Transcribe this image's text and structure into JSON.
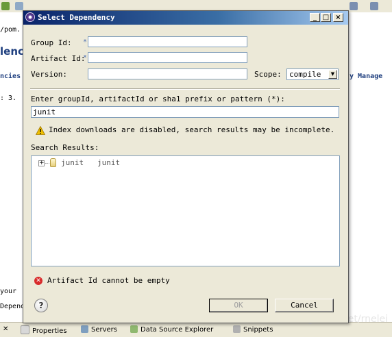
{
  "background": {
    "editor_fragments": [
      "/pom.",
      "lenc",
      "ncies",
      "y Manage",
      ": 3.",
      "your",
      "Depend"
    ],
    "bottom_tabs": [
      {
        "label": "Properties",
        "icon": "properties-icon"
      },
      {
        "label": "Servers",
        "icon": "servers-icon"
      },
      {
        "label": "Data Source Explorer",
        "icon": "data-source-icon"
      },
      {
        "label": "Snippets",
        "icon": "snippets-icon"
      }
    ],
    "watermark": "http://blog.csdn.net/rnelei"
  },
  "dialog": {
    "title": "Select Dependency",
    "window_controls": {
      "minimize": "_",
      "maximize": "□",
      "close": "×"
    },
    "group_id": {
      "label": "Group Id:",
      "value": "",
      "required_mark": "*"
    },
    "artifact_id": {
      "label": "Artifact Id:",
      "value": "",
      "required_mark": "*"
    },
    "version": {
      "label": "Version:",
      "value": ""
    },
    "scope": {
      "label": "Scope:",
      "value": "compile"
    },
    "search": {
      "label": "Enter groupId, artifactId or sha1 prefix or pattern (*):",
      "value": "junit"
    },
    "warning": "Index downloads are disabled, search results may be incomplete.",
    "results": {
      "label": "Search Results:",
      "items": [
        {
          "text": "junit   junit",
          "expand": "+"
        }
      ]
    },
    "error": "Artifact Id cannot be empty",
    "help": "?",
    "ok_label": "OK",
    "cancel_label": "Cancel"
  },
  "colors": {
    "title_start": "#0a246a",
    "title_end": "#a6caf0",
    "dialog_bg": "#ece9d8",
    "error": "#d82b2b",
    "warning": "#f0c000"
  }
}
